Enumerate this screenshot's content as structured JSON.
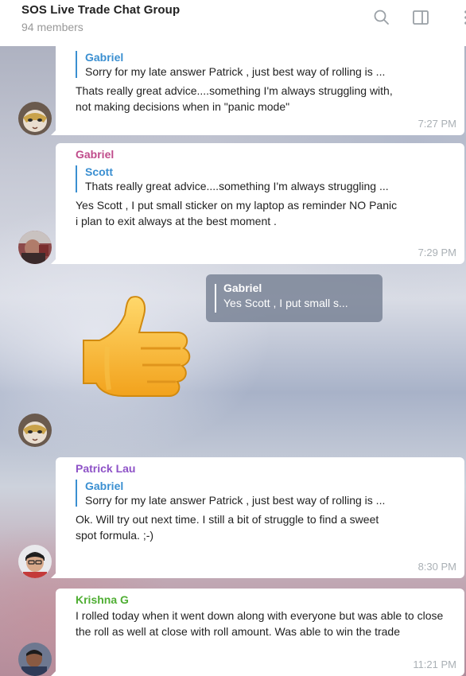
{
  "header": {
    "title": "SOS Live Trade Chat Group",
    "members": "94 members",
    "icons": [
      "search-icon",
      "sidebar-toggle-icon",
      "more-vertical-icon"
    ]
  },
  "messages": [
    {
      "reply": {
        "name": "Gabriel",
        "text": "Sorry for my late answer Patrick , just best way of rolling is ..."
      },
      "body": "Thats really great advice....something I'm always struggling with, not making decisions when in \"panic mode\"",
      "time": "7:27 PM"
    },
    {
      "sender": "Gabriel",
      "sender_color": "#c04c8b",
      "reply": {
        "name": "Scott",
        "text": "Thats really great advice....something I'm always struggling ..."
      },
      "body": "Yes Scott , I put small sticker on my laptop as reminder NO Panic i plan to exit always at the best moment .",
      "time": "7:29 PM"
    },
    {
      "type": "sticker",
      "sticker": "thumbs-up",
      "reply": {
        "name": "Gabriel",
        "text": "Yes Scott , I put small s..."
      }
    },
    {
      "sender": "Patrick Lau",
      "sender_color": "#8e52c7",
      "reply": {
        "name": "Gabriel",
        "text": "Sorry for my late answer Patrick , just best way of rolling is ..."
      },
      "body": "Ok. Will try out next time. I still a bit of struggle to find a sweet spot formula. ;-)",
      "time": "8:30 PM"
    },
    {
      "sender": "Krishna G",
      "sender_color": "#4fae33",
      "body": "I rolled today when it went down along with everyone but was able to close the roll as well at close with roll amount. Was able to win the trade",
      "time": "11:21 PM"
    }
  ]
}
